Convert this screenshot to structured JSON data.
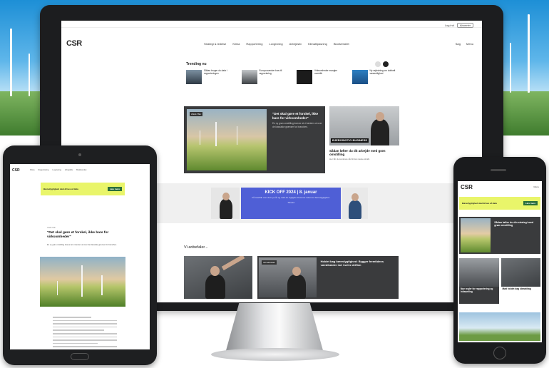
{
  "site": {
    "logo": "CSR",
    "top_links": [
      "Log ind",
      "Abonnér"
    ],
    "menu": [
      "Strategi & ledelse",
      "Klima",
      "Rapportering",
      "Lovgivning",
      "Arbejdsliv",
      "Klimatilpasning",
      "Biodiversitet"
    ],
    "header_actions": [
      "Søg",
      "Menu"
    ]
  },
  "desktop": {
    "trending_title": "Trending nu",
    "trending": [
      {
        "label": "Sådan bruger du data i rapporteringen"
      },
      {
        "label": "Europa sænker krav til rapportering"
      },
      {
        "label": "Virksomheder mangler overblik"
      },
      {
        "label": "Ny vejledning om dobbelt væsentlighed"
      }
    ],
    "feature": {
      "badge": "ANALYSE",
      "headline": "\"Det skal gøre et forskel, ikke bare for virksomheder\"",
      "lead": "En ny grøn omstilling kræver at vi tænker ud over de klassiske grænser for branchen."
    },
    "side_card": {
      "badge": "BJERGSIGTIG BUSINESS",
      "headline": "Sådan løfter du dit arbejde med grøn omstilling",
      "lead": "Her får du konkrete råd til det næste skridt."
    },
    "ad": {
      "headline": "KICK OFF 2024 | 8. januar",
      "text": "Få overblik over det nye år og mød de vigtigste stemmer inden for bæredygtighed.",
      "cta": "Tilmeld"
    },
    "recommend_title": "Vi anbefaler...",
    "rec_card": {
      "badge": "INTERVIEW",
      "headline": "Holdet bag bæredygtighed: Bygger fremtidens værdikæder ind i selve driften"
    }
  },
  "tablet": {
    "nav": [
      "Klima",
      "Rapportering",
      "Lovgivning",
      "Arbejdsliv",
      "Biodiversitet"
    ],
    "ad_text": "Bæredygtighed skal drives af data",
    "ad_cta": "Læs mere",
    "kicker": "ANALYSE",
    "title": "\"Det skal gøre et forskel, ikke bare for virksomheder\"",
    "lead": "En ny grøn omstilling kræver at vi tænker ud over de klassiske grænser for branchen."
  },
  "phone": {
    "menu": "Menu",
    "ad_text": "Bæredygtighed skal drives af data",
    "ad_cta": "Læs mere",
    "feature_headline": "Sådan løfter du din strategi med grøn omstilling",
    "cards": [
      "Nye regler for rapportering og indsamling",
      "Mød holdet bag klimatiltag"
    ]
  }
}
